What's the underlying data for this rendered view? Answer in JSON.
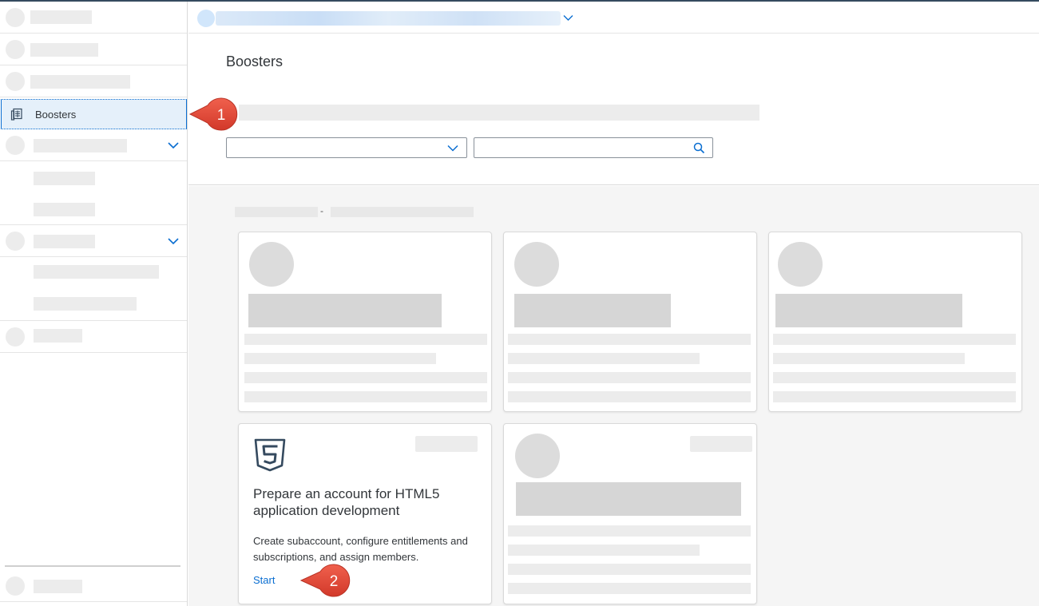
{
  "sidebar": {
    "active_item": {
      "label": "Boosters",
      "icon": "boosters-icon"
    }
  },
  "page": {
    "title": "Boosters"
  },
  "booster_card": {
    "icon": "html5-icon",
    "title": "Prepare an account for HTML5 application development",
    "description": "Create subaccount, configure entitlements and subscriptions, and assign members.",
    "action_label": "Start"
  },
  "annotations": {
    "callout_1": "1",
    "callout_2": "2"
  },
  "colors": {
    "accent": "#0a6ed1",
    "callout": "#e24a3b",
    "html5_icon": "#354a5f"
  }
}
